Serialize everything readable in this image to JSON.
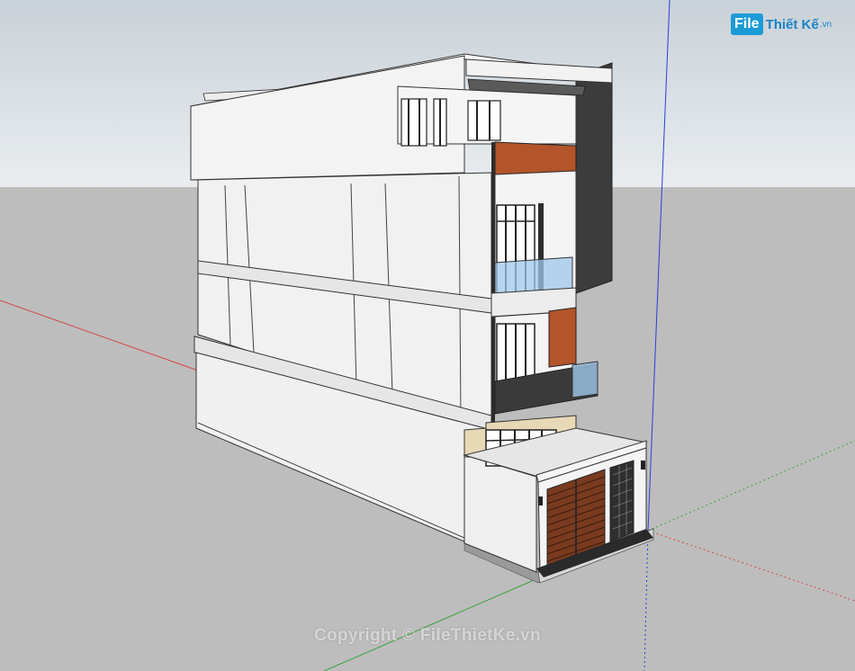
{
  "app": {
    "title": "3D house model viewport"
  },
  "logo": {
    "file": "File",
    "rest": "Thiết Kế",
    "tld": ".vn"
  },
  "watermark": {
    "text": "Copyright © FileThietKe.vn"
  },
  "colors": {
    "sky_top": "#c7cfd6",
    "sky_bottom": "#e9edf0",
    "ground": "#bcbcbc",
    "wall": "#f2f2f2",
    "wall_shade": "#e4e4e4",
    "dark_panel": "#3a3a3a",
    "wood": "#b3542a",
    "glass": "#9fc7ea",
    "gate_wood": "#7a3a1e",
    "axis_red": "#d64545",
    "axis_green": "#3ca23c",
    "axis_blue": "#2a3fd8"
  },
  "icons": [
    "filethietke-logo"
  ]
}
